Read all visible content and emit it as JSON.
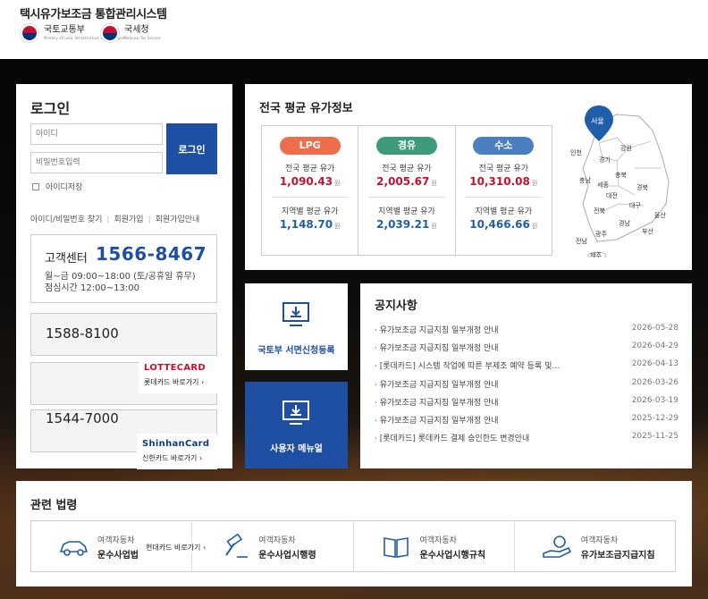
{
  "header": {
    "title": "택시유가보조금 통합관리시스템",
    "logos": [
      {
        "name": "국토교통부",
        "sub": "Ministry of Land, Infrastructure and Transport"
      },
      {
        "name": "국세청",
        "sub": "National Tax Service"
      }
    ]
  },
  "login": {
    "title": "로그인",
    "id_placeholder": "아이디",
    "pw_placeholder": "비밀번호입력",
    "button": "로그인",
    "remember": "아이디저장",
    "links": [
      "아이디/비밀번호 찾기",
      "회원가입",
      "회원가입안내"
    ],
    "customer_center": {
      "label": "고객센터",
      "number": "1566-8467",
      "hours1": "월~금 09:00~18:00 (토/공휴일 휴무)",
      "hours2": "점심시간 12:00~13:00"
    },
    "cards": [
      {
        "number": "1588-8100",
        "brand": "LOTTECARD",
        "link": "롯데카드 바로가기 ›"
      },
      {
        "number": "1544-7000",
        "brand": "ShinhanCard",
        "link": "신한카드 바로가기 ›"
      }
    ],
    "hyundai_link": "현대카드 바로가기 ›"
  },
  "fuel": {
    "title": "전국 평균 유가정보",
    "items": [
      {
        "type": "LPG",
        "color": "#ef6d4a",
        "avg_label": "전국 평균 유가",
        "avg": "1,090.43",
        "reg_label": "지역별 평균 유가",
        "reg": "1,148.70",
        "unit": "원"
      },
      {
        "type": "경유",
        "color": "#3d9b7a",
        "avg_label": "전국 평균 유가",
        "avg": "2,005.67",
        "reg_label": "지역별 평균 유가",
        "reg": "2,039.21",
        "unit": "원"
      },
      {
        "type": "수소",
        "color": "#4a7fc1",
        "avg_label": "전국 평균 유가",
        "avg": "10,310.08",
        "reg_label": "지역별 평균 유가",
        "reg": "10,466.66",
        "unit": "원"
      }
    ],
    "map": {
      "selected": "서울",
      "regions": [
        "인천",
        "경기",
        "강원",
        "충북",
        "충남",
        "세종",
        "대전",
        "경북",
        "전북",
        "대구",
        "울산",
        "경남",
        "부산",
        "광주",
        "전남",
        "제주"
      ]
    }
  },
  "quick": {
    "register": "국토부 서면신청등록",
    "manual": "사용자 메뉴얼"
  },
  "notice": {
    "title": "공지사항",
    "items": [
      {
        "title": "유가보조금 지급지침 일부개정 안내",
        "date": "2026-05-28"
      },
      {
        "title": "유가보조금 지급지침 일부개정 안내",
        "date": "2026-04-29"
      },
      {
        "title": "[롯데카드] 시스템 작업에 따른 부제조 예약 등록 및…",
        "date": "2026-04-13"
      },
      {
        "title": "유가보조금 지급지침 일부개정 안내",
        "date": "2026-03-26"
      },
      {
        "title": "유가보조금 지급지침 일부개정 안내",
        "date": "2026-03-19"
      },
      {
        "title": "유가보조금 지급지침 일부개정 안내",
        "date": "2025-12-29"
      },
      {
        "title": "[롯데카드] 롯데카드 결제 승인한도 변경안내",
        "date": "2025-11-25"
      }
    ]
  },
  "laws": {
    "title": "관련 법령",
    "items": [
      {
        "line1": "여객자동차",
        "line2": "운수사업법",
        "icon": "car-icon"
      },
      {
        "line1": "여객자동차",
        "line2": "운수사업시행령",
        "icon": "gavel-icon"
      },
      {
        "line1": "여객자동차",
        "line2": "운수사업시행규칙",
        "icon": "book-icon"
      },
      {
        "line1": "여객자동차",
        "line2": "유가보조금지급지침",
        "icon": "hand-money-icon"
      }
    ]
  }
}
